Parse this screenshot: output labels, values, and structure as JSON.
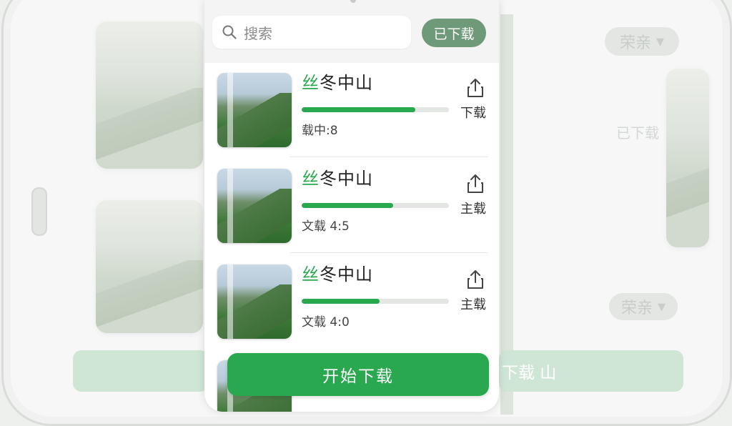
{
  "search": {
    "placeholder": "搜索"
  },
  "header": {
    "downloaded_label": "已下载"
  },
  "items": [
    {
      "title_accent": "丝",
      "title_rest": "冬中山",
      "progress": 0.77,
      "status": "载中:8",
      "action_label": "下载"
    },
    {
      "title_accent": "丝",
      "title_rest": "冬中山",
      "progress": 0.62,
      "status": "文载 4:5",
      "action_label": "主载"
    },
    {
      "title_accent": "丝",
      "title_rest": "冬中山",
      "progress": 0.53,
      "status": "文载 4:0",
      "action_label": "主载"
    }
  ],
  "footer": {
    "start_label": "开始下载"
  },
  "background": {
    "dropdown_label": "荣亲",
    "status_label": "已下载",
    "action_label": "下载 山"
  },
  "colors": {
    "accent": "#2aa84f",
    "pill": "#6f9a79"
  }
}
